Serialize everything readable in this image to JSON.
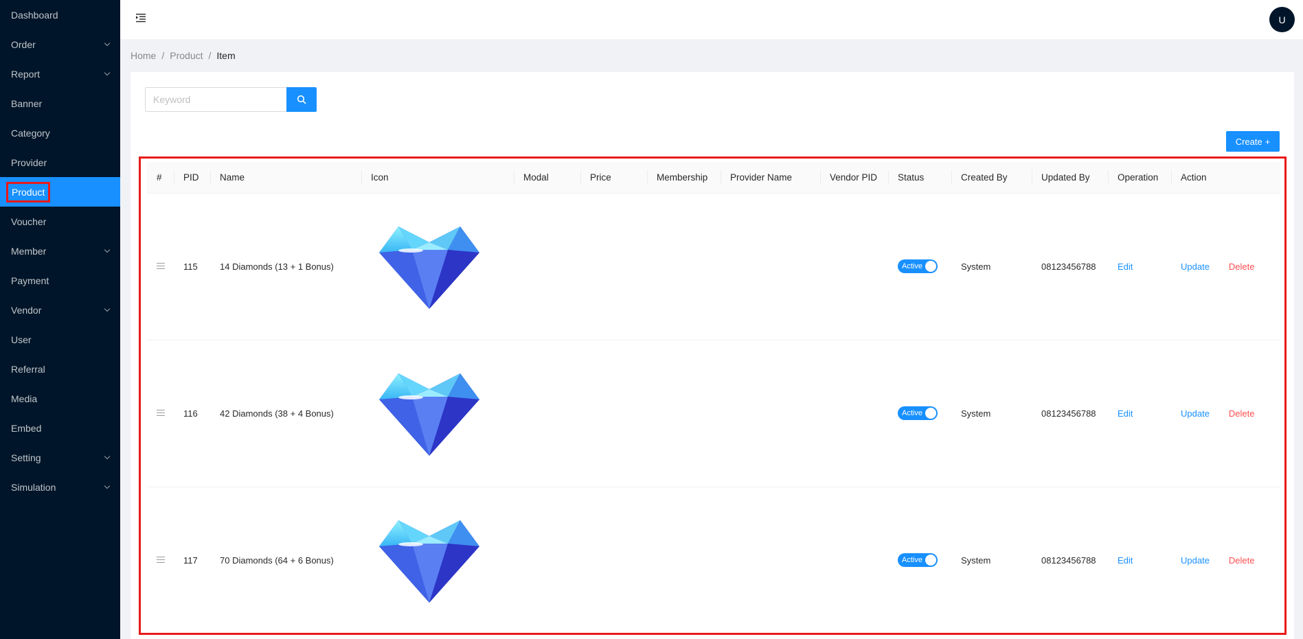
{
  "sidebar": {
    "items": [
      {
        "label": "Dashboard",
        "has_children": false
      },
      {
        "label": "Order",
        "has_children": true
      },
      {
        "label": "Report",
        "has_children": true
      },
      {
        "label": "Banner",
        "has_children": false
      },
      {
        "label": "Category",
        "has_children": false
      },
      {
        "label": "Provider",
        "has_children": false
      },
      {
        "label": "Product",
        "has_children": false,
        "active": true
      },
      {
        "label": "Voucher",
        "has_children": false
      },
      {
        "label": "Member",
        "has_children": true
      },
      {
        "label": "Payment",
        "has_children": false
      },
      {
        "label": "Vendor",
        "has_children": true
      },
      {
        "label": "User",
        "has_children": false
      },
      {
        "label": "Referral",
        "has_children": false
      },
      {
        "label": "Media",
        "has_children": false
      },
      {
        "label": "Embed",
        "has_children": false
      },
      {
        "label": "Setting",
        "has_children": true
      },
      {
        "label": "Simulation",
        "has_children": true
      }
    ]
  },
  "header": {
    "menu_icon": "menu-fold-icon",
    "avatar_initial": "U"
  },
  "breadcrumb": {
    "home": "Home",
    "section": "Product",
    "current": "Item",
    "separator": "/"
  },
  "search": {
    "placeholder": "Keyword",
    "value": "",
    "button_icon": "search-icon"
  },
  "create_button": {
    "label": "Create",
    "icon": "+"
  },
  "table": {
    "columns": [
      "#",
      "PID",
      "Name",
      "Icon",
      "Modal",
      "Price",
      "Membership",
      "Provider Name",
      "Vendor PID",
      "Status",
      "Created By",
      "Updated By",
      "Operation",
      "Action"
    ],
    "rows": [
      {
        "pid": "115",
        "name": "14 Diamonds (13 + 1 Bonus)",
        "icon": "diamond-image",
        "modal": "",
        "price": "",
        "membership": "",
        "provider_name": "",
        "vendor_pid": "",
        "status": "Active",
        "created_by": "System",
        "updated_by": "08123456788",
        "operation": "Edit",
        "action_update": "Update",
        "action_delete": "Delete"
      },
      {
        "pid": "116",
        "name": "42 Diamonds (38 + 4 Bonus)",
        "icon": "diamond-image",
        "modal": "",
        "price": "",
        "membership": "",
        "provider_name": "",
        "vendor_pid": "",
        "status": "Active",
        "created_by": "System",
        "updated_by": "08123456788",
        "operation": "Edit",
        "action_update": "Update",
        "action_delete": "Delete"
      },
      {
        "pid": "117",
        "name": "70 Diamonds (64 + 6 Bonus)",
        "icon": "diamond-image",
        "modal": "",
        "price": "",
        "membership": "",
        "provider_name": "",
        "vendor_pid": "",
        "status": "Active",
        "created_by": "System",
        "updated_by": "08123456788",
        "operation": "Edit",
        "action_update": "Update",
        "action_delete": "Delete"
      }
    ]
  },
  "colors": {
    "sidebar_bg": "#001529",
    "primary": "#1890ff",
    "danger": "#ff4d4f",
    "highlight": "#e81a1a"
  }
}
